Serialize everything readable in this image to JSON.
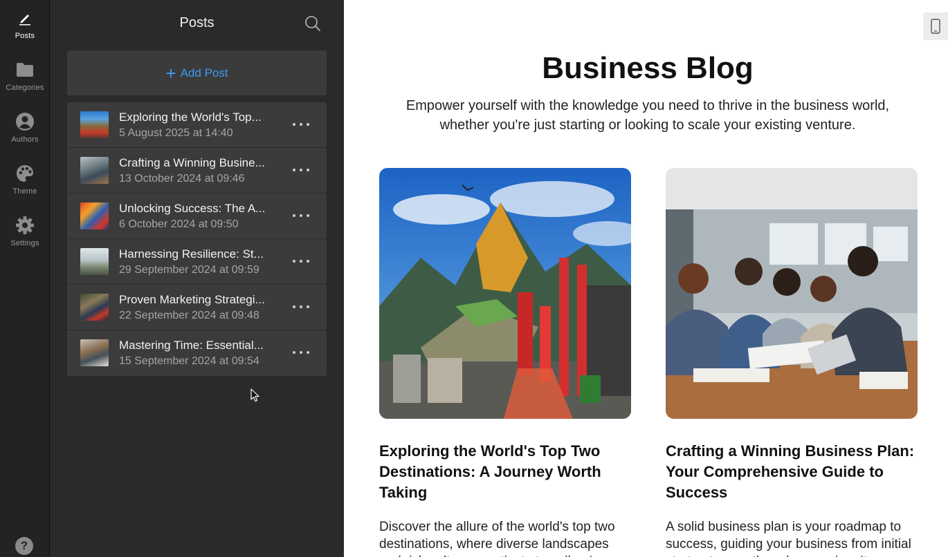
{
  "nav": {
    "items": [
      {
        "label": "Posts",
        "icon": "pencil-icon"
      },
      {
        "label": "Categories",
        "icon": "folder-icon"
      },
      {
        "label": "Authors",
        "icon": "user-icon"
      },
      {
        "label": "Theme",
        "icon": "palette-icon"
      },
      {
        "label": "Settings",
        "icon": "gear-icon"
      }
    ],
    "help": "?"
  },
  "panel": {
    "title": "Posts",
    "add_label": "Add Post",
    "posts": [
      {
        "title": "Exploring the World's Top...",
        "date": "5 August 2025 at 14:40"
      },
      {
        "title": "Crafting a Winning Busine...",
        "date": "13 October 2024 at 09:46"
      },
      {
        "title": "Unlocking Success: The A...",
        "date": "6 October 2024 at 09:50"
      },
      {
        "title": "Harnessing Resilience: St...",
        "date": "29 September 2024 at 09:59"
      },
      {
        "title": "Proven Marketing Strategi...",
        "date": "22 September 2024 at 09:48"
      },
      {
        "title": "Mastering Time: Essential...",
        "date": "15 September 2024 at 09:54"
      }
    ]
  },
  "preview": {
    "title": "Business Blog",
    "subtitle": "Empower yourself with the knowledge you need to thrive in the business world, whether you're just starting or looking to scale your existing venture.",
    "cards": [
      {
        "title": "Exploring the World's Top Two Destinations: A Journey Worth Taking",
        "excerpt": "Discover the allure of the world's top two destinations, where diverse landscapes and rich cultures captivate travellers!"
      },
      {
        "title": "Crafting a Winning Business Plan: Your Comprehensive Guide to Success",
        "excerpt": "A solid business plan is your roadmap to success, guiding your business from initial startup to growth and expansion. It"
      }
    ]
  },
  "colors": {
    "accent": "#3e9bf2",
    "rail_bg": "#232323",
    "panel_bg": "#2a2a2a",
    "row_bg": "#3b3b3b"
  }
}
